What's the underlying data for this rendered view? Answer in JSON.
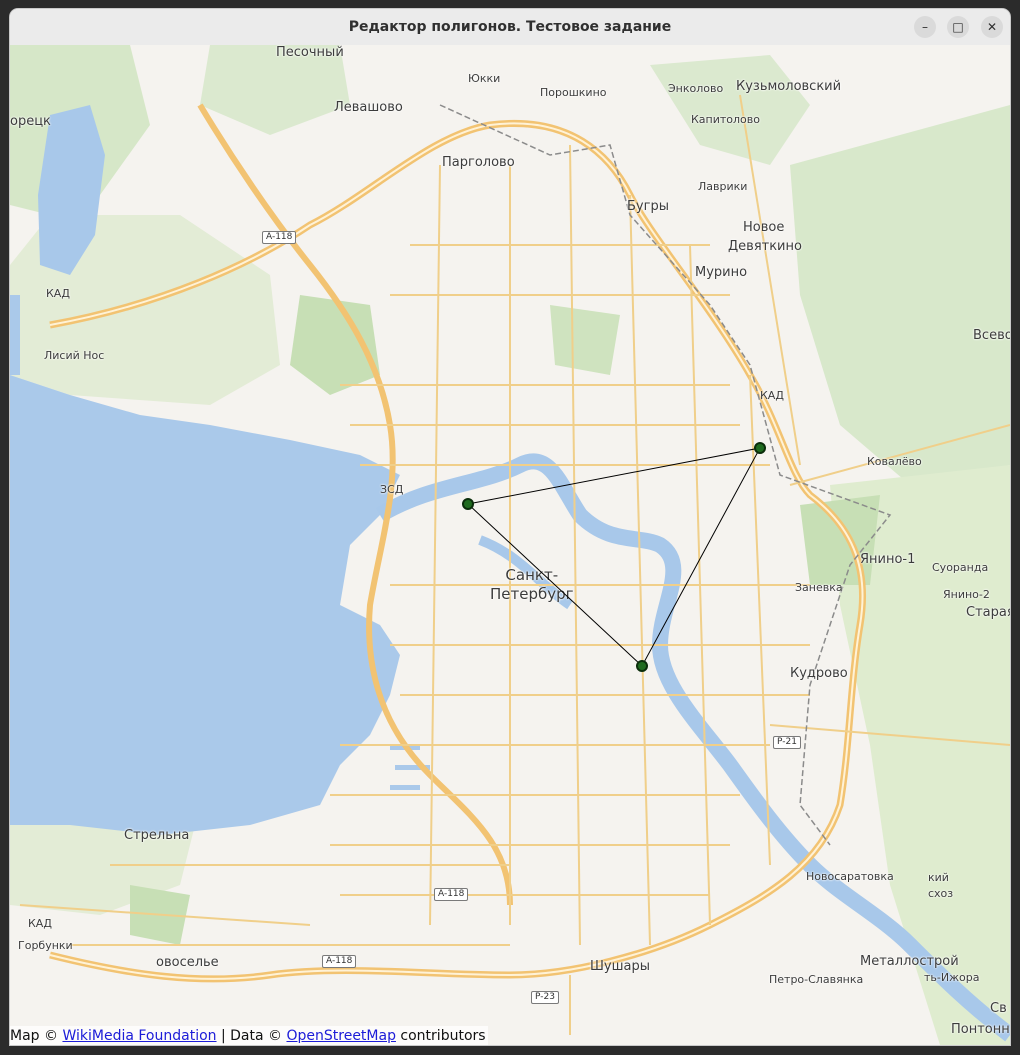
{
  "window": {
    "title": "Редактор полигонов. Тестовое задание",
    "controls": {
      "minimize": "–",
      "maximize": "□",
      "close": "✕"
    }
  },
  "map": {
    "labels": {
      "pesochny": "Песочный",
      "yukki": "Юкки",
      "enkolovo": "Энколово",
      "kuzmolovsky": "Кузьмоловский",
      "levashovo": "Левашово",
      "poroshkino": "Порошкино",
      "sestroretsk": "орецк",
      "kapitolovo": "Капитолово",
      "pargolovo": "Парголово",
      "lavriki": "Лаврики",
      "bugry": "Бугры",
      "novoe_devyatkino_1": "Новое",
      "novoe_devyatkino_2": "Девяткино",
      "murino": "Мурино",
      "vsevolozhsk": "Всево",
      "lisiy_nos": "Лисий Нос",
      "kovalevo": "Ковалёво",
      "yanino1": "Янино-1",
      "suoranda": "Суоранда",
      "zanevka": "Заневка",
      "yanino2": "Янино-2",
      "staraya": "Старая",
      "spb_1": "Санкт-",
      "spb_2": "Петербург",
      "kudrovo": "Кудрово",
      "strelna": "Стрельна",
      "novosaratovka": "Новосаратовка",
      "sovkhoz_1": "кий",
      "sovkhoz_2": "схоз",
      "gorbunki": "Горбунки",
      "novoselye": "овоселье",
      "shushary": "Шушары",
      "metallostroy": "Металлострой",
      "petro_slavyanka": "Петро-Славянка",
      "izhora": "ть-Ижора",
      "pontonny": "Понтонн",
      "sv": "Св"
    },
    "shields": {
      "a118_top": "A-118",
      "a118_bottom": "A-118",
      "a118_bottom2": "A-118",
      "r21": "P-21",
      "r23": "P-23"
    },
    "road_labels": {
      "kad": "КАД",
      "zsd": "ЗСД"
    }
  },
  "polygon": {
    "stroke_color": "#000000",
    "vertex_color": "#1f6b1f",
    "vertex_count": 3
  },
  "attribution": {
    "prefix": "Map ©",
    "wikimedia": "WikiMedia Foundation",
    "middle": "| Data ©",
    "osm": "OpenStreetMap",
    "suffix": "contributors"
  }
}
